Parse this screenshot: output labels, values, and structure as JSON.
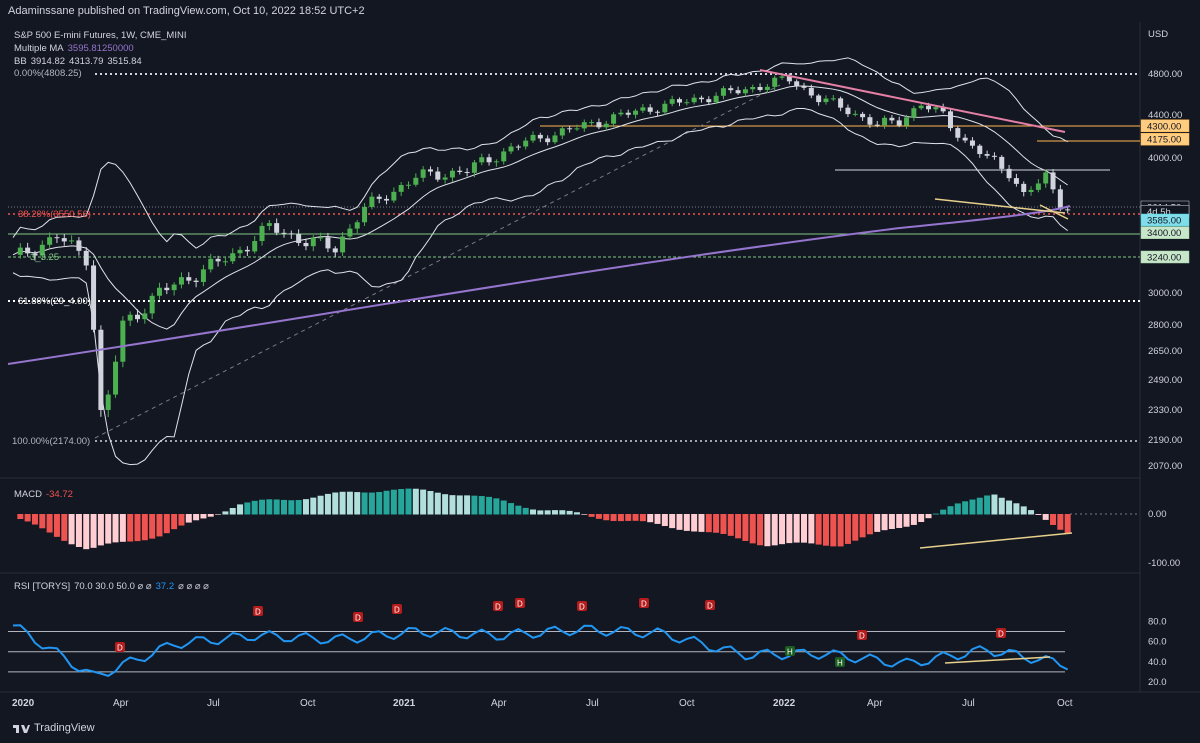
{
  "header": {
    "published": "Adaminssane published on TradingView.com, Oct 10, 2022 18:52 UTC+2"
  },
  "legend": {
    "symbol": "S&P 500 E-mini Futures, 1W, CME_MINI",
    "ma_label": "Multiple MA",
    "ma_value": "3595.81250000",
    "bb_label": "BB",
    "bb_v1": "3914.82",
    "bb_v2": "4313.79",
    "bb_v3": "3515.84",
    "fib_top": "0.00%(4808.25)"
  },
  "fib": {
    "f382": "38.20%(3550.56)",
    "f618": "61.80%(29_4.00)",
    "f100": "100.00%(2174.00)",
    "f236": "3_3.25"
  },
  "price_axis": {
    "currency": "USD",
    "ticks": [
      "4800.00",
      "4400.00",
      "4000.00",
      "3000.00",
      "2800.00",
      "2650.00",
      "2490.00",
      "2330.00",
      "2190.00",
      "2070.00"
    ]
  },
  "price_labels": [
    {
      "text": "4300.00",
      "color": "#ffb74d",
      "fill": "#ffcc80",
      "textColor": "#131722",
      "value": 4300
    },
    {
      "text": "4175.00",
      "color": "#ffb74d",
      "fill": "#ffcc80",
      "textColor": "#131722",
      "value": 4175
    },
    {
      "text": "3614.50",
      "color": "#d1d4dc",
      "fill": "#131722",
      "textColor": "#d1d4dc",
      "value": 3614.5
    },
    {
      "text": "4d 5h",
      "color": "#d1d4dc",
      "fill": "#131722",
      "textColor": "#d1d4dc",
      "value": 3575
    },
    {
      "text": "3585.00",
      "color": "#4dd0e1",
      "fill": "#80deea",
      "textColor": "#131722",
      "value": 3505
    },
    {
      "text": "3400.00",
      "color": "#a5d6a7",
      "fill": "#c8e6c9",
      "textColor": "#131722",
      "value": 3410
    },
    {
      "text": "3240.00",
      "color": "#a5d6a7",
      "fill": "#c8e6c9",
      "textColor": "#131722",
      "value": 3240
    }
  ],
  "macd": {
    "label": "MACD",
    "value": "-34.72",
    "ticks": [
      "0.00",
      "-100.00"
    ]
  },
  "rsi": {
    "label": "RSI [TORYS]",
    "params": "70.0  30.0  50.0  ⌀  ⌀",
    "value": "37.2",
    "tail": "⌀  ⌀  ⌀  ⌀",
    "ticks": [
      "80.0",
      "60.0",
      "40.0",
      "20.0"
    ]
  },
  "time_axis": [
    "2020",
    "Apr",
    "Jul",
    "Oct",
    "2021",
    "Apr",
    "Jul",
    "Oct",
    "2022",
    "Apr",
    "Jul",
    "Oct"
  ],
  "brand": "TradingView",
  "colors": {
    "up": "#4caf50",
    "down": "#d1d4dc",
    "bg": "#131722",
    "ma": "#9575cd",
    "trend": "#e57fa5",
    "macdPos": "#26a69a",
    "macdNeg": "#ef5350",
    "rsi": "#2196f3",
    "divergence": "#e6d08c"
  },
  "chart_data": {
    "type": "line",
    "title": "S&P 500 E-mini Futures, 1W, CME_MINI",
    "ylabel": "USD",
    "x": [
      "2020",
      "Apr",
      "Jul",
      "Oct",
      "2021",
      "Apr",
      "Jul",
      "Oct",
      "2022",
      "Apr",
      "Jul",
      "Oct"
    ],
    "ylim": [
      2050,
      4900
    ],
    "series": [
      {
        "name": "S&P 500 E-mini Futures",
        "values": [
          3230,
          2300,
          3100,
          3300,
          3750,
          4150,
          4350,
          4600,
          4750,
          4500,
          3950,
          4200,
          3614.5
        ]
      }
    ],
    "macd_values": [
      -5,
      -70,
      -40,
      20,
      35,
      50,
      40,
      10,
      -10,
      -30,
      -60,
      -60,
      -15,
      45,
      -35
    ],
    "rsi_values": [
      76,
      25,
      58,
      66,
      62,
      70,
      66,
      72,
      68,
      47,
      48,
      38,
      52,
      37.2
    ]
  }
}
